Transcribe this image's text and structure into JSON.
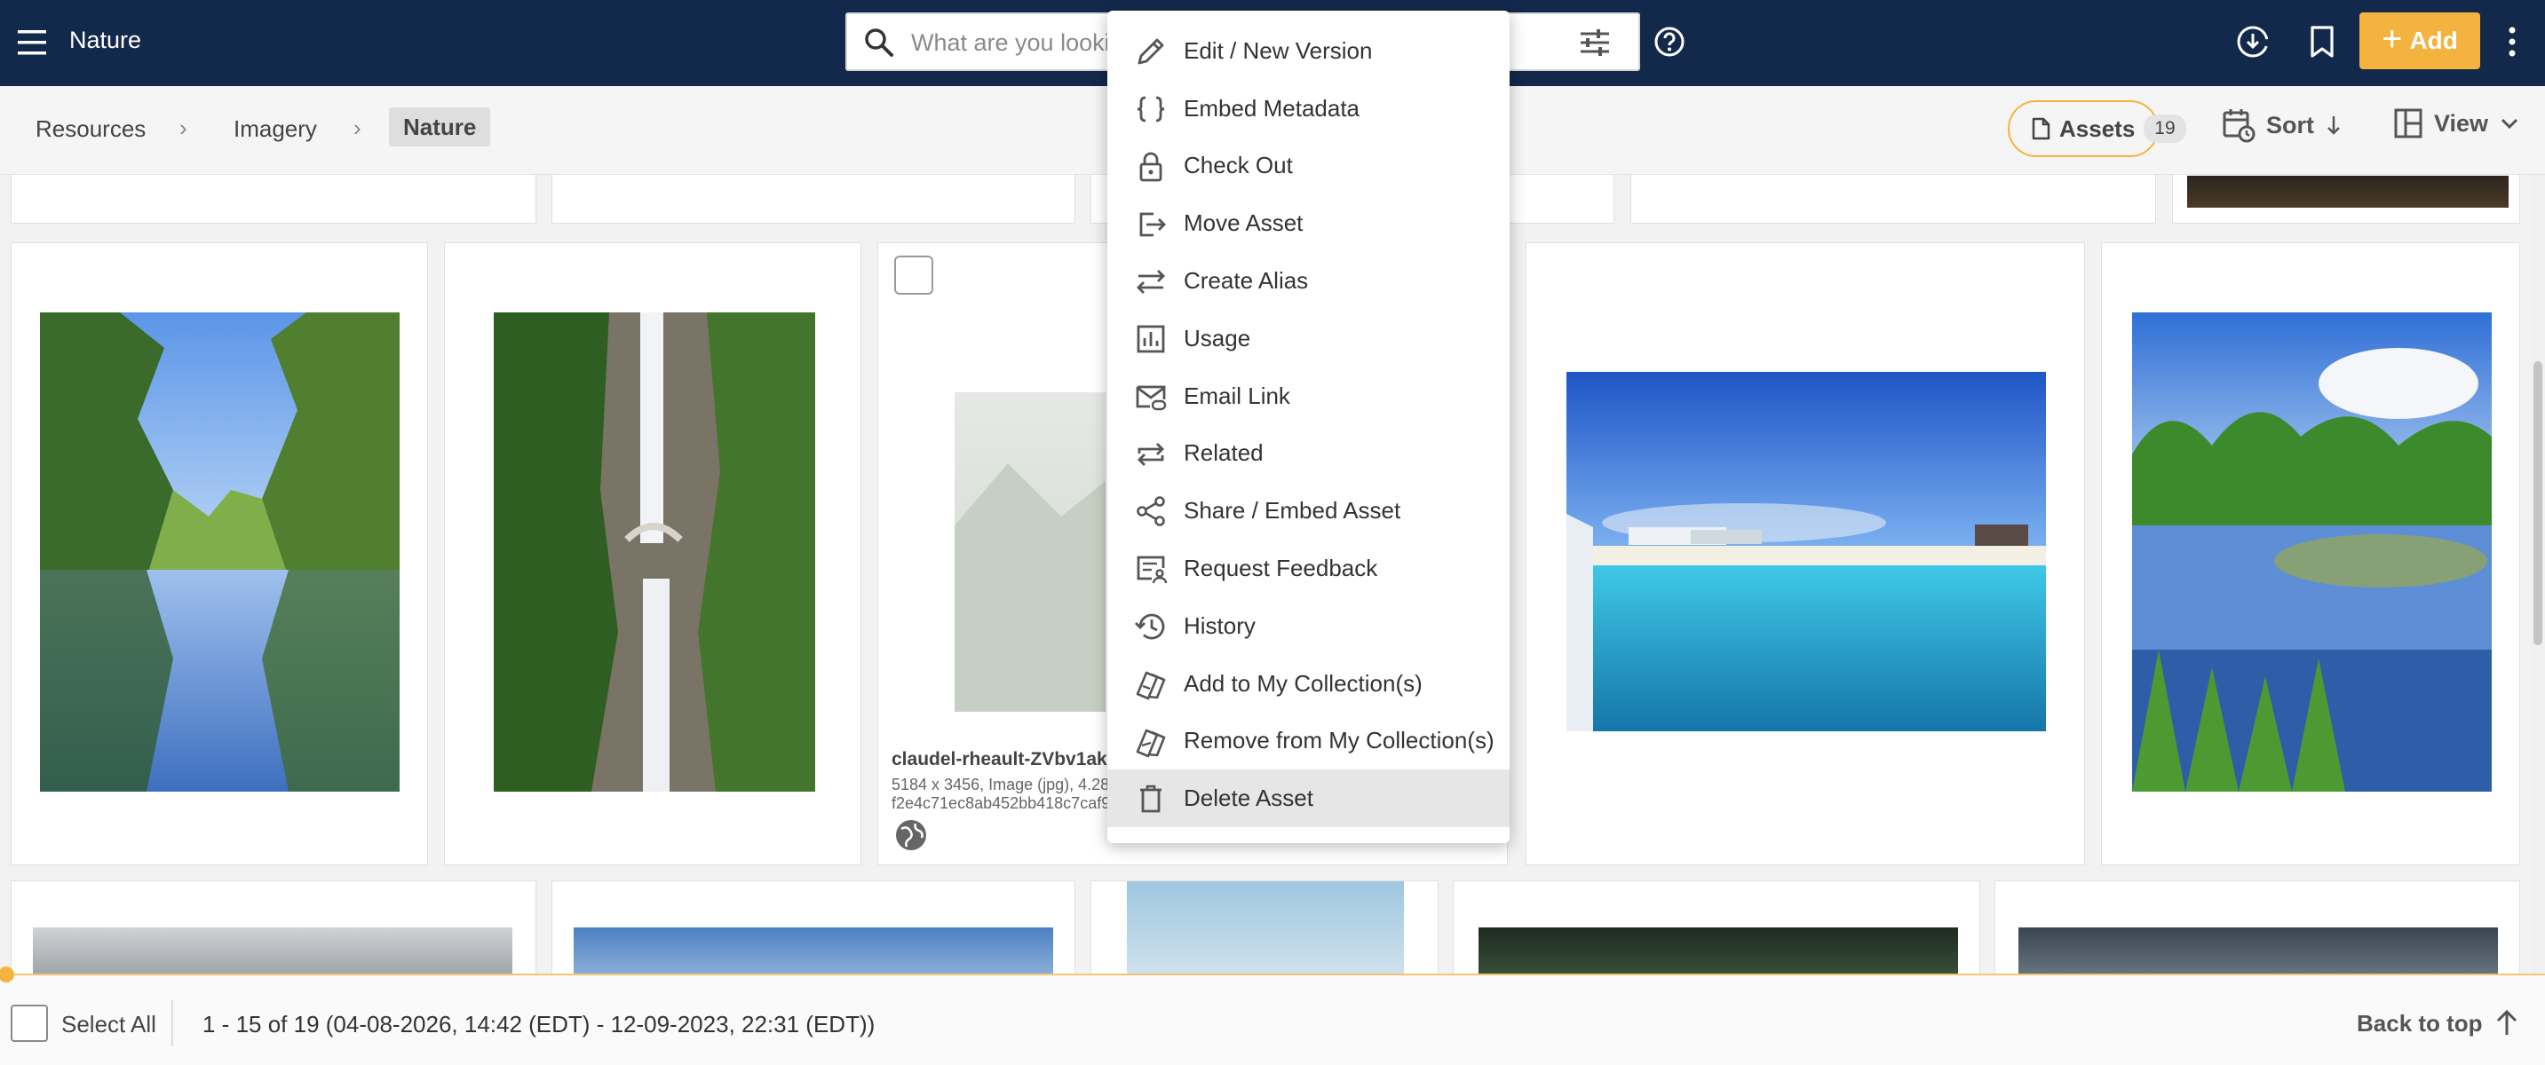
{
  "topbar": {
    "title": "Nature",
    "search_placeholder": "What are you looking for?",
    "add_label": "Add"
  },
  "breadcrumb": {
    "items": [
      "Resources",
      "Imagery"
    ],
    "current": "Nature"
  },
  "toolbar": {
    "assets_label": "Assets",
    "assets_count": "19",
    "sort_label": "Sort",
    "view_label": "View"
  },
  "card": {
    "title": "claudel-rheault-ZVbv1ak",
    "meta_line1": "5184 x 3456, Image (jpg), 4.28",
    "meta_line2": "f2e4c71ec8ab452bb418c7caf9"
  },
  "context_menu": {
    "items": [
      {
        "label": "Edit / New Version",
        "icon": "pencil-icon"
      },
      {
        "label": "Embed Metadata",
        "icon": "braces-icon"
      },
      {
        "label": "Check Out",
        "icon": "lock-icon"
      },
      {
        "label": "Move Asset",
        "icon": "move-icon"
      },
      {
        "label": "Create Alias",
        "icon": "swap-arrows-icon"
      },
      {
        "label": "Usage",
        "icon": "bar-chart-icon"
      },
      {
        "label": "Email Link",
        "icon": "email-link-icon"
      },
      {
        "label": "Related",
        "icon": "repeat-icon"
      },
      {
        "label": "Share / Embed Asset",
        "icon": "share-icon"
      },
      {
        "label": "Request Feedback",
        "icon": "feedback-icon"
      },
      {
        "label": "History",
        "icon": "history-icon"
      },
      {
        "label": "Add to My Collection(s)",
        "icon": "collection-add-icon"
      },
      {
        "label": "Remove from My Collection(s)",
        "icon": "collection-remove-icon"
      },
      {
        "label": "Delete Asset",
        "icon": "trash-icon"
      }
    ],
    "highlighted": "Delete Asset"
  },
  "footer": {
    "select_all": "Select All",
    "range": "1 - 15 of 19 (04-08-2026, 14:42 (EDT) - 12-09-2023, 22:31 (EDT))",
    "back_to_top": "Back to top"
  },
  "colors": {
    "topbar": "#13294b",
    "accent": "#f4b33f"
  }
}
